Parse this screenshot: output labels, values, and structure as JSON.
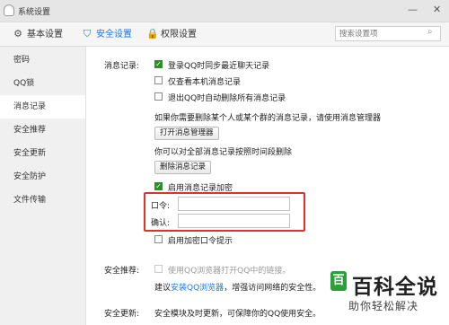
{
  "window": {
    "title": "系统设置",
    "controls": {
      "minimize": "—",
      "close": "✕"
    }
  },
  "toolbar": {
    "tabs": [
      {
        "label": "基本设置",
        "icon": "gear-icon",
        "active": false
      },
      {
        "label": "安全设置",
        "icon": "shield-icon",
        "active": true
      },
      {
        "label": "权限设置",
        "icon": "lock-icon",
        "active": false
      }
    ],
    "search": {
      "placeholder": "搜索设置项",
      "value": ""
    }
  },
  "sidebar": {
    "items": [
      {
        "label": "密码",
        "active": false
      },
      {
        "label": "QQ锁",
        "active": false
      },
      {
        "label": "消息记录",
        "active": true
      },
      {
        "label": "安全推荐",
        "active": false
      },
      {
        "label": "安全更新",
        "active": false
      },
      {
        "label": "安全防护",
        "active": false
      },
      {
        "label": "文件传输",
        "active": false
      }
    ]
  },
  "message_log": {
    "section_label": "消息记录:",
    "options": [
      {
        "label": "登录QQ时同步最近聊天记录",
        "checked": true
      },
      {
        "label": "仅查看本机消息记录",
        "checked": false
      },
      {
        "label": "退出QQ时自动删除所有消息记录",
        "checked": false
      }
    ],
    "manager_hint": "如果你需要删除某个人或某个群的消息记录，请使用消息管理器",
    "open_manager_button": "打开消息管理器",
    "delete_hint": "你可以对全部消息记录按照时间段删除",
    "delete_button": "删除消息记录",
    "encrypt_option": {
      "label": "启用消息记录加密",
      "checked": true
    },
    "password_label": "口令:",
    "confirm_label": "确认:",
    "password_value": "",
    "confirm_value": "",
    "hint_option": {
      "label": "启用加密口令提示",
      "checked": false
    }
  },
  "security_recommend": {
    "section_label": "安全推荐:",
    "option": {
      "label": "使用QQ浏览器打开QQ中的链接。",
      "checked": false
    },
    "suggest_prefix": "建议",
    "suggest_link": "安装QQ浏览器",
    "suggest_suffix": "，增强访问网络的安全性。"
  },
  "security_update": {
    "section_label": "安全更新:",
    "description": "安全模块及时更新，可保障你的QQ使用安全。"
  },
  "watermark": {
    "logo_glyph": "百",
    "title": "百科全说",
    "subtitle": "助你轻松解决"
  },
  "colors": {
    "accent": "#1e78d8",
    "highlight_box": "#e0312b",
    "checkbox_checked": "#2e8e2e"
  }
}
